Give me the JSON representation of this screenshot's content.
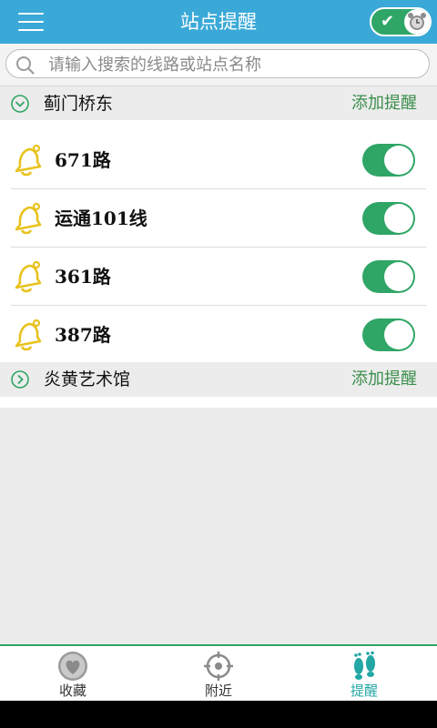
{
  "header": {
    "title": "站点提醒",
    "toggle_on": true
  },
  "search": {
    "placeholder": "请输入搜索的线路或站点名称",
    "value": ""
  },
  "stations": [
    {
      "name": "蓟门桥东",
      "add_label": "添加提醒",
      "expanded": true,
      "routes": [
        {
          "name": "671路",
          "enabled": true
        },
        {
          "name": "运通101线",
          "enabled": true
        },
        {
          "name": "361路",
          "enabled": true
        },
        {
          "name": "387路",
          "enabled": true
        }
      ]
    },
    {
      "name": "炎黄艺术馆",
      "add_label": "添加提醒",
      "expanded": false
    }
  ],
  "bottom_nav": {
    "items": [
      {
        "label": "收藏",
        "icon": "heart-icon",
        "active": false
      },
      {
        "label": "附近",
        "icon": "target-icon",
        "active": false
      },
      {
        "label": "提醒",
        "icon": "footprints-icon",
        "active": true
      }
    ]
  },
  "colors": {
    "header_bg": "#3aa9d8",
    "accent_green": "#2fa566",
    "add_text": "#3c8f4d",
    "bell_yellow": "#e8c21c",
    "active_tab": "#23a7a5"
  }
}
